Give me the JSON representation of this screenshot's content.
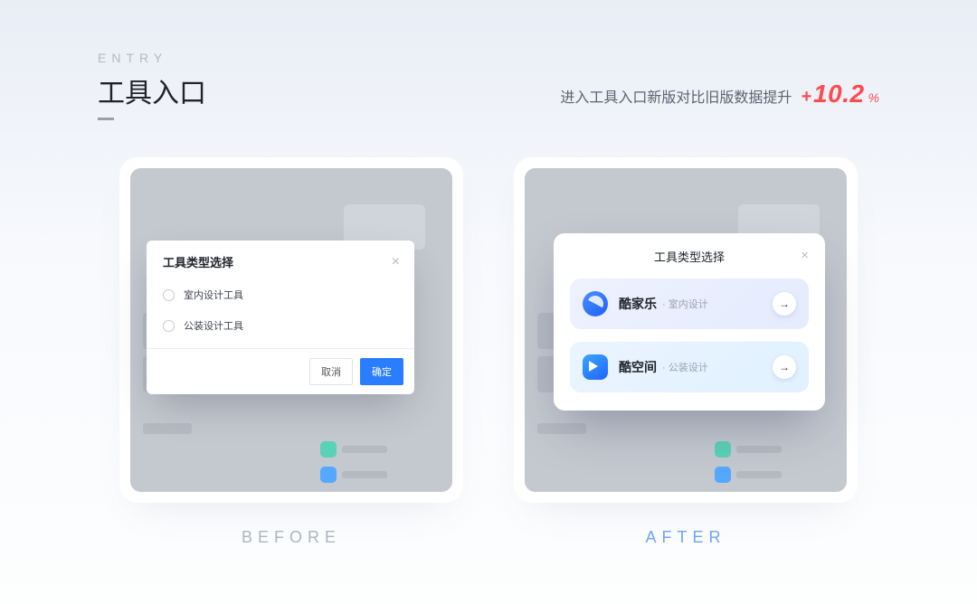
{
  "header": {
    "eyebrow": "ENTRY",
    "title": "工具入口"
  },
  "stat": {
    "text": "进入工具入口新版对比旧版数据提升",
    "plus": "+",
    "value": "10.2",
    "percent": "%"
  },
  "labels": {
    "before": "BEFORE",
    "after": "AFTER"
  },
  "before_modal": {
    "title": "工具类型选择",
    "options": [
      {
        "label": "室内设计工具"
      },
      {
        "label": "公装设计工具"
      }
    ],
    "cancel": "取消",
    "confirm": "确定"
  },
  "after_modal": {
    "title": "工具类型选择",
    "cards": [
      {
        "name": "酷家乐",
        "sub": "室内设计",
        "arrow": "→"
      },
      {
        "name": "酷空间",
        "sub": "公装设计",
        "arrow": "→"
      }
    ]
  }
}
